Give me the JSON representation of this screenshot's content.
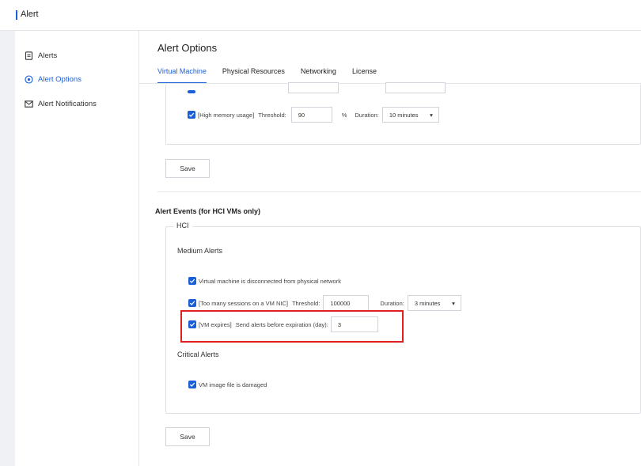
{
  "app": {
    "title": "Alert"
  },
  "sidebar": {
    "items": [
      {
        "label": "Alerts",
        "icon": "document-icon"
      },
      {
        "label": "Alert Options",
        "icon": "target-icon",
        "active": true
      },
      {
        "label": "Alert Notifications",
        "icon": "mail-icon"
      }
    ]
  },
  "main": {
    "title": "Alert Options",
    "tabs": [
      {
        "label": "Virtual Machine",
        "active": true
      },
      {
        "label": "Physical Resources"
      },
      {
        "label": "Networking"
      },
      {
        "label": "License"
      }
    ],
    "vm_options": {
      "high_memory": {
        "label": "[High memory usage]",
        "threshold_label": "Threshold:",
        "threshold_value": "90",
        "unit": "%",
        "duration_label": "Duration:",
        "duration_value": "10 minutes"
      },
      "save_label": "Save"
    },
    "alert_events": {
      "title": "Alert Events (for HCI VMs only)",
      "group_legend": "HCI",
      "medium_title": "Medium Alerts",
      "medium_items": {
        "disconnected": "Virtual machine is disconnected from physical network",
        "sessions": {
          "label": "[Too many sessions on a VM NIC]",
          "threshold_label": "Threshold:",
          "threshold_value": "100000",
          "duration_label": "Duration:",
          "duration_value": "3 minutes"
        },
        "vm_expires": {
          "label": "[VM expires]",
          "text": "Send alerts before expiration (day):",
          "value": "3"
        }
      },
      "critical_title": "Critical Alerts",
      "critical_items": {
        "image_damaged": "VM image file is damaged"
      },
      "save_label": "Save"
    }
  },
  "colors": {
    "accent": "#1a5fd8",
    "highlight": "#e02020"
  }
}
